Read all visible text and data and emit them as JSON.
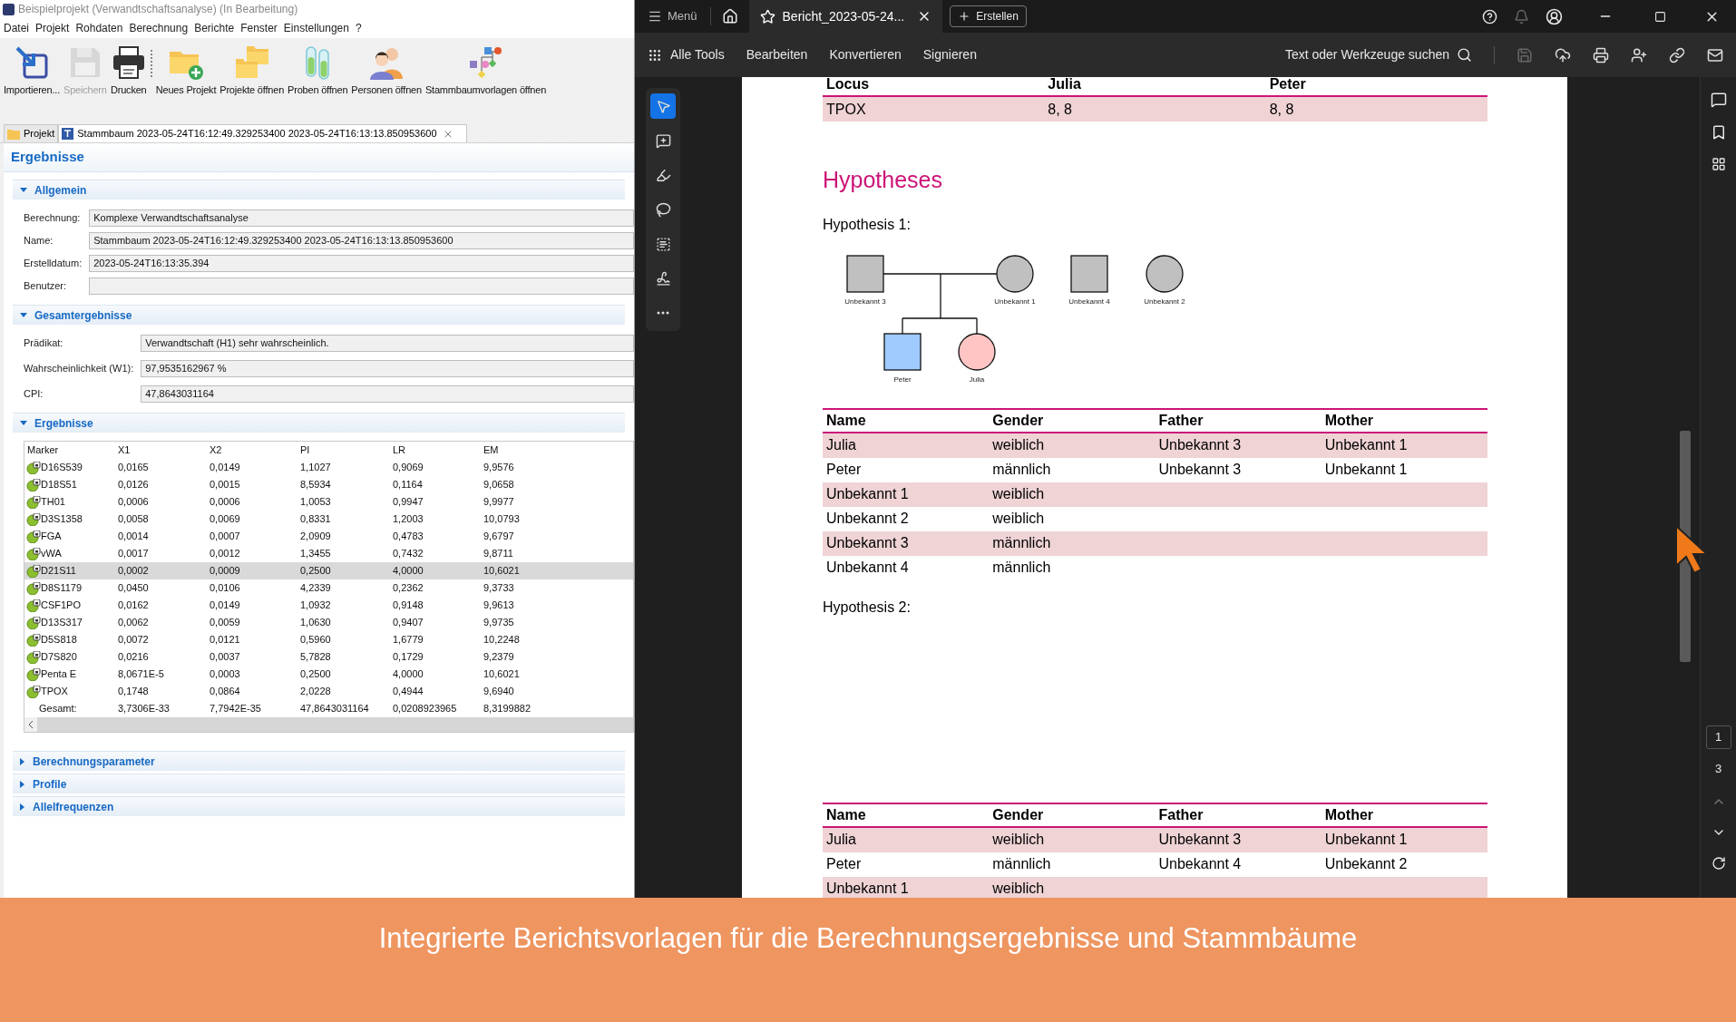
{
  "left_window": {
    "title": "Beispielprojekt (Verwandtschaftsanalyse) (In Bearbeitung)",
    "menu": [
      "Datei",
      "Projekt",
      "Rohdaten",
      "Berechnung",
      "Berichte",
      "Fenster",
      "Einstellungen",
      "?"
    ],
    "toolbar": [
      {
        "kind": "import",
        "label": "Importieren...",
        "disabled": false
      },
      {
        "kind": "save",
        "label": "Speichern",
        "disabled": true
      },
      {
        "kind": "print",
        "label": "Drucken",
        "disabled": false
      },
      {
        "kind": "new-project",
        "label": "Neues Projekt",
        "disabled": false
      },
      {
        "kind": "open-projects",
        "label": "Projekte öffnen",
        "disabled": false
      },
      {
        "kind": "open-samples",
        "label": "Proben öffnen",
        "disabled": false
      },
      {
        "kind": "open-persons",
        "label": "Personen öffnen",
        "disabled": false
      },
      {
        "kind": "open-templates",
        "label": "Stammbaumvorlagen öffnen",
        "disabled": false
      }
    ],
    "editor_tabs": [
      {
        "kind": "folder",
        "label": "Projekt",
        "selected": false
      },
      {
        "kind": "pedigree",
        "label": "Stammbaum 2023-05-24T16:12:49.329253400 2023-05-24T16:13:13.850953600",
        "selected": true
      }
    ],
    "results": {
      "title": "Ergebnisse",
      "sections": [
        {
          "kind": "fields",
          "title": "Allgemein",
          "expanded": true,
          "fields": [
            {
              "label": "Berechnung:",
              "value": "Komplexe Verwandtschaftsanalyse"
            },
            {
              "label": "Name:",
              "value": "Stammbaum 2023-05-24T16:12:49.329253400 2023-05-24T16:13:13.850953600"
            },
            {
              "label": "Erstelldatum:",
              "value": "2023-05-24T16:13:35.394"
            },
            {
              "label": "Benutzer:"
            }
          ]
        },
        {
          "kind": "fields",
          "title": "Gesamtergebnisse",
          "expanded": true,
          "fields": [
            {
              "label": "Prädikat:",
              "value": "Verwandtschaft (H1) sehr wahrscheinlich."
            },
            {
              "label": "Wahrscheinlichkeit (W1):",
              "value": "97,9535162967 %"
            },
            {
              "label": "CPI:",
              "value": "47,8643031164"
            }
          ]
        },
        {
          "kind": "table",
          "title": "Ergebnisse",
          "expanded": true,
          "columns": [
            "Marker",
            "X1",
            "X2",
            "PI",
            "LR",
            "EM"
          ],
          "rows": [
            {
              "kind": "marker",
              "selected": false,
              "cells": [
                "D16S539",
                "0,0165",
                "0,0149",
                "1,1027",
                "0,9069",
                "9,9576"
              ]
            },
            {
              "kind": "marker",
              "selected": false,
              "cells": [
                "D18S51",
                "0,0126",
                "0,0015",
                "8,5934",
                "0,1164",
                "9,0658"
              ]
            },
            {
              "kind": "marker",
              "selected": false,
              "cells": [
                "TH01",
                "0,0006",
                "0,0006",
                "1,0053",
                "0,9947",
                "9,9977"
              ]
            },
            {
              "kind": "marker",
              "selected": false,
              "cells": [
                "D3S1358",
                "0,0058",
                "0,0069",
                "0,8331",
                "1,2003",
                "10,0793"
              ]
            },
            {
              "kind": "marker",
              "selected": false,
              "cells": [
                "FGA",
                "0,0014",
                "0,0007",
                "2,0909",
                "0,4783",
                "9,6797"
              ]
            },
            {
              "kind": "marker",
              "selected": false,
              "cells": [
                "vWA",
                "0,0017",
                "0,0012",
                "1,3455",
                "0,7432",
                "9,8711"
              ]
            },
            {
              "kind": "marker",
              "selected": true,
              "cells": [
                "D21S11",
                "0,0002",
                "0,0009",
                "0,2500",
                "4,0000",
                "10,6021"
              ]
            },
            {
              "kind": "marker",
              "selected": false,
              "cells": [
                "D8S1179",
                "0,0450",
                "0,0106",
                "4,2339",
                "0,2362",
                "9,3733"
              ]
            },
            {
              "kind": "marker",
              "selected": false,
              "cells": [
                "CSF1PO",
                "0,0162",
                "0,0149",
                "1,0932",
                "0,9148",
                "9,9613"
              ]
            },
            {
              "kind": "marker",
              "selected": false,
              "cells": [
                "D13S317",
                "0,0062",
                "0,0059",
                "1,0630",
                "0,9407",
                "9,9735"
              ]
            },
            {
              "kind": "marker",
              "selected": false,
              "cells": [
                "D5S818",
                "0,0072",
                "0,0121",
                "0,5960",
                "1,6779",
                "10,2248"
              ]
            },
            {
              "kind": "marker",
              "selected": false,
              "cells": [
                "D7S820",
                "0,0216",
                "0,0037",
                "5,7828",
                "0,1729",
                "9,2379"
              ]
            },
            {
              "kind": "marker",
              "selected": false,
              "cells": [
                "Penta E",
                "8,0671E-5",
                "0,0003",
                "0,2500",
                "4,0000",
                "10,6021"
              ]
            },
            {
              "kind": "marker",
              "selected": false,
              "cells": [
                "TPOX",
                "0,1748",
                "0,0864",
                "2,0228",
                "0,4944",
                "9,6940"
              ]
            },
            {
              "kind": "total",
              "selected": false,
              "cells": [
                "Gesamt:",
                "3,7306E-33",
                "7,7942E-35",
                "47,8643031164",
                "0,0208923965",
                "8,3199882"
              ]
            }
          ]
        },
        {
          "title": "Berechnungsparameter",
          "expanded": false
        },
        {
          "title": "Profile",
          "expanded": false
        },
        {
          "title": "Allelfrequenzen",
          "expanded": false
        }
      ]
    }
  },
  "viewer": {
    "menu_label": "Menü",
    "tab_title": "Bericht_2023-05-24...",
    "create_label": "Erstellen",
    "tool_menu": [
      "Alle Tools",
      "Bearbeiten",
      "Konvertieren",
      "Signieren"
    ],
    "search_label": "Text oder Werkzeuge suchen",
    "actions": [
      {
        "kind": "save",
        "disabled": true
      },
      {
        "kind": "upload",
        "disabled": false
      },
      {
        "kind": "print",
        "disabled": false
      },
      {
        "kind": "share",
        "disabled": false
      },
      {
        "kind": "link",
        "disabled": false
      },
      {
        "kind": "mail",
        "disabled": false
      }
    ],
    "side_tools": [
      {
        "kind": "select",
        "selected": true
      },
      {
        "kind": "comment",
        "selected": false
      },
      {
        "kind": "draw",
        "selected": false
      },
      {
        "kind": "lasso",
        "selected": false
      },
      {
        "kind": "text-select",
        "selected": false
      },
      {
        "kind": "sign",
        "selected": false
      },
      {
        "kind": "more",
        "selected": false
      }
    ],
    "pages": {
      "current": "1",
      "total": "3"
    },
    "document": {
      "allele_table": {
        "columns": [
          "Locus",
          "Julia",
          "Peter"
        ],
        "rows": [
          [
            "TPOX",
            "8, 8",
            "8, 8"
          ]
        ]
      },
      "heading": "Hypotheses",
      "hypotheses": [
        {
          "title": "Hypothesis 1:",
          "pedigree": [
            {
              "name": "Unbekannt 3",
              "kind": "square",
              "color": "#c0c0c0"
            },
            {
              "name": "Unbekannt 1",
              "kind": "circle",
              "color": "#c0c0c0"
            },
            {
              "name": "Unbekannt 4",
              "kind": "square",
              "color": "#c0c0c0"
            },
            {
              "name": "Unbekannt 2",
              "kind": "circle",
              "color": "#c0c0c0"
            },
            {
              "name": "Peter",
              "kind": "square",
              "color": "#9fcbff"
            },
            {
              "name": "Julia",
              "kind": "circle",
              "color": "#ffc5c5"
            }
          ],
          "table": {
            "columns": [
              "Name",
              "Gender",
              "Father",
              "Mother"
            ],
            "rows": [
              [
                "Julia",
                "weiblich",
                "Unbekannt 3",
                "Unbekannt 1"
              ],
              [
                "Peter",
                "männlich",
                "Unbekannt 3",
                "Unbekannt 1"
              ],
              [
                "Unbekannt 1",
                "weiblich",
                "",
                ""
              ],
              [
                "Unbekannt 2",
                "weiblich",
                "",
                ""
              ],
              [
                "Unbekannt 3",
                "männlich",
                "",
                ""
              ],
              [
                "Unbekannt 4",
                "männlich",
                "",
                ""
              ]
            ]
          }
        },
        {
          "title": "Hypothesis 2:",
          "table": {
            "columns": [
              "Name",
              "Gender",
              "Father",
              "Mother"
            ],
            "rows": [
              [
                "Julia",
                "weiblich",
                "Unbekannt 3",
                "Unbekannt 1"
              ],
              [
                "Peter",
                "männlich",
                "Unbekannt 4",
                "Unbekannt 2"
              ],
              [
                "Unbekannt 1",
                "weiblich",
                "",
                ""
              ]
            ]
          }
        }
      ]
    }
  },
  "banner": "Integrierte Berichtsvorlagen für die Berechnungsergebnisse und Stammbäume"
}
